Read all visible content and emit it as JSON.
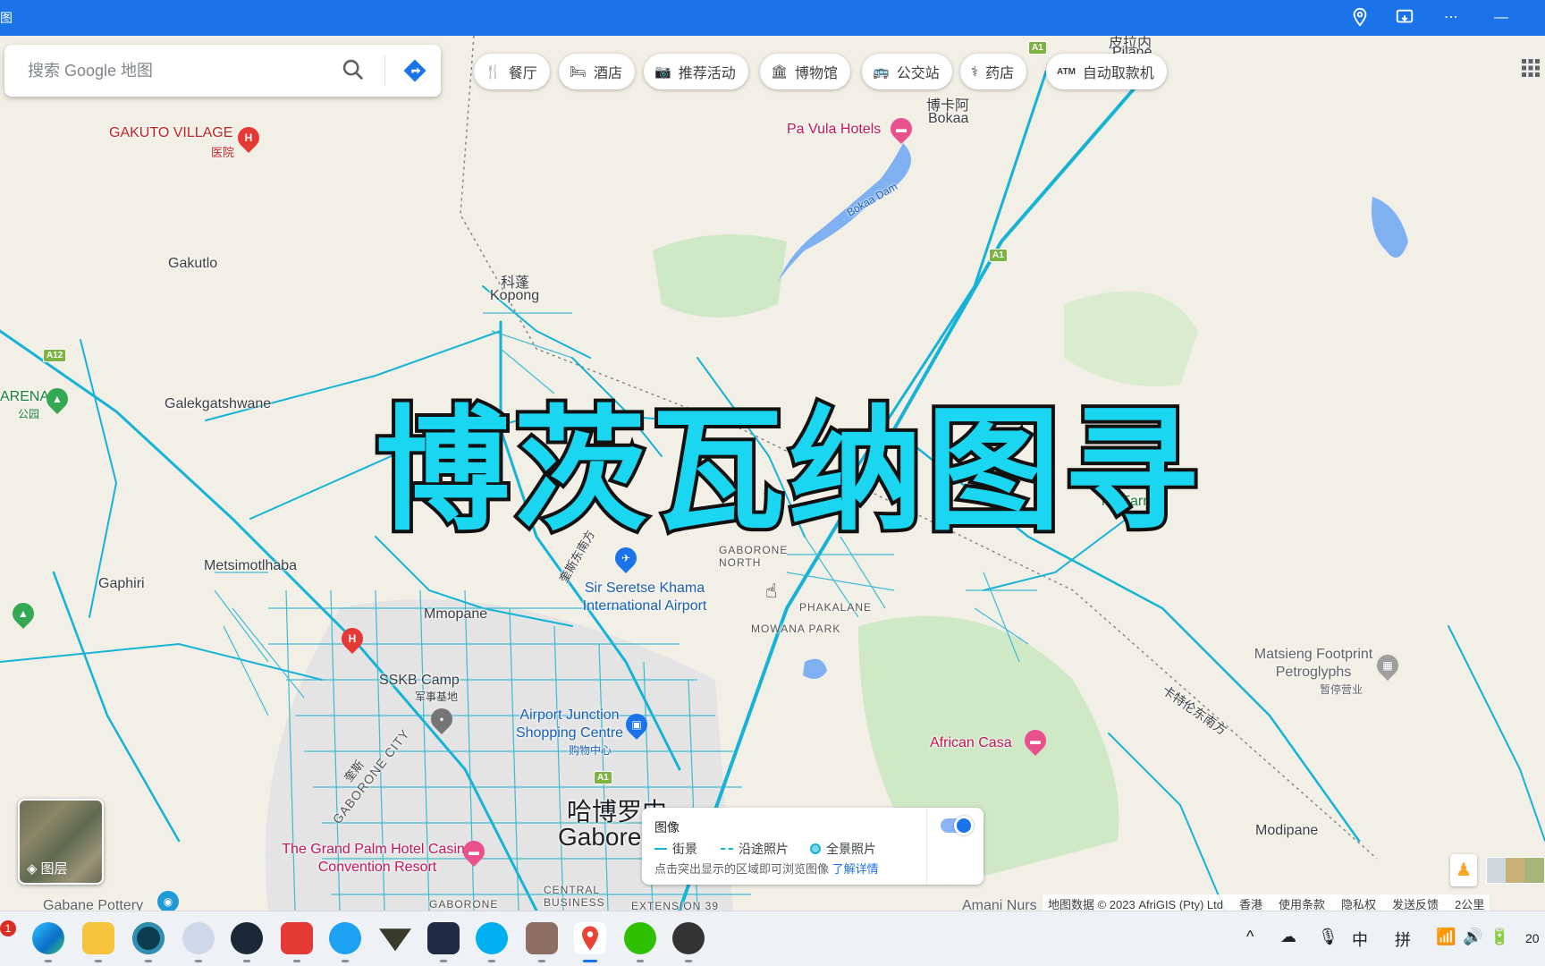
{
  "titlebar": {
    "left_glyph": "图"
  },
  "search": {
    "placeholder": "搜索 Google 地图"
  },
  "chips": [
    {
      "icon": "fork-knife-icon",
      "glyph": "🍴",
      "label": "餐厅"
    },
    {
      "icon": "bed-icon",
      "glyph": "🛏",
      "label": "酒店"
    },
    {
      "icon": "camera-icon",
      "glyph": "📷",
      "label": "推荐活动"
    },
    {
      "icon": "museum-icon",
      "glyph": "🏛",
      "label": "博物馆"
    },
    {
      "icon": "bus-icon",
      "glyph": "🚌",
      "label": "公交站"
    },
    {
      "icon": "pharmacy-icon",
      "glyph": "⚕",
      "label": "药店"
    },
    {
      "icon": "atm-icon",
      "glyph": "ATM",
      "label": "自动取款机"
    }
  ],
  "overlay_title": "博茨瓦纳图寻",
  "map_labels": {
    "pilane_zh": "皮拉内",
    "pilane": "Pilane",
    "gakuto_village": "GAKUTO VILLAGE",
    "gakuto_hospital": "医院",
    "pa_vula": "Pa Vula Hotels",
    "bokaa_zh": "博卡阿",
    "bokaa": "Bokaa",
    "bokaa_dam": "Bokaa Dam",
    "gakutlo": "Gakutlo",
    "kopong_zh": "科蓬",
    "kopong": "Kopong",
    "arena": "ARENA",
    "arena_zh": "公园",
    "galekgatshwane": "Galekgatshwane",
    "farm": "ng Farm",
    "metsimotlhaba": "Metsimotlhaba",
    "gaphiri": "Gaphiri",
    "mmopane": "Mmopane",
    "airport_zh": "奎斯东南方",
    "airport": "Sir Seretse Khama International Airport",
    "gaborone_north": "GABORONE NORTH",
    "phakalane": "PHAKALANE",
    "mowana_park": "MOWANA PARK",
    "sskb": "SSKB Camp",
    "sskb_zh": "军事基地",
    "airport_junction": "Airport Junction Shopping Centre",
    "airport_junction_zh": "购物中心",
    "matsieng": "Matsieng Footprint Petroglyphs",
    "matsieng_zh": "暂停营业",
    "katlo_zh": "卡特伦东南方",
    "african_casa": "African Casa",
    "gaborone_city": "GABORONE CITY",
    "gaborone_city_zh": "奎斯",
    "grand_palm": "The Grand Palm Hotel Casino Convention Resort",
    "gaborone_zh": "哈博罗内",
    "gaborone": "Gabore",
    "modipane": "Modipane",
    "gabane_pottery": "Gabane Pottery",
    "gaborone_small": "GABORONE",
    "central_business": "CENTRAL BUSINESS",
    "extension": "EXTENSION 39",
    "amani": "Amani Nurs",
    "a1": "A1",
    "a12": "A12"
  },
  "layers": {
    "label": "图层"
  },
  "imagery": {
    "title": "图像",
    "legend": [
      "街景",
      "沿途照片",
      "全景照片"
    ],
    "hint": "点击突出显示的区域即可浏览图像",
    "more_link": "了解详情",
    "toggle_on": true
  },
  "attribution": [
    "地图数据 © 2023 AfriGIS (Pty) Ltd",
    "香港",
    "使用条款",
    "隐私权",
    "发送反馈",
    "2公里"
  ],
  "taskbar": {
    "badge": "1",
    "apps": [
      "edge-icon",
      "file-explorer-icon",
      "app-circle-icon",
      "settings-gear-icon",
      "steam-icon",
      "netease-music-icon",
      "app-m-icon",
      "app-triangle-icon",
      "app-cat-icon",
      "skype-icon",
      "minecraft-icon",
      "google-maps-icon",
      "wechat-icon",
      "app-bomb-icon"
    ],
    "tray": {
      "chevron": "^",
      "ime_zh": "中",
      "ime_pin": "拼",
      "clock": "20"
    }
  },
  "colors": {
    "street_view": "#16b3d6",
    "accent": "#1a73e8",
    "overlay_fill": "#1ad6f0"
  }
}
